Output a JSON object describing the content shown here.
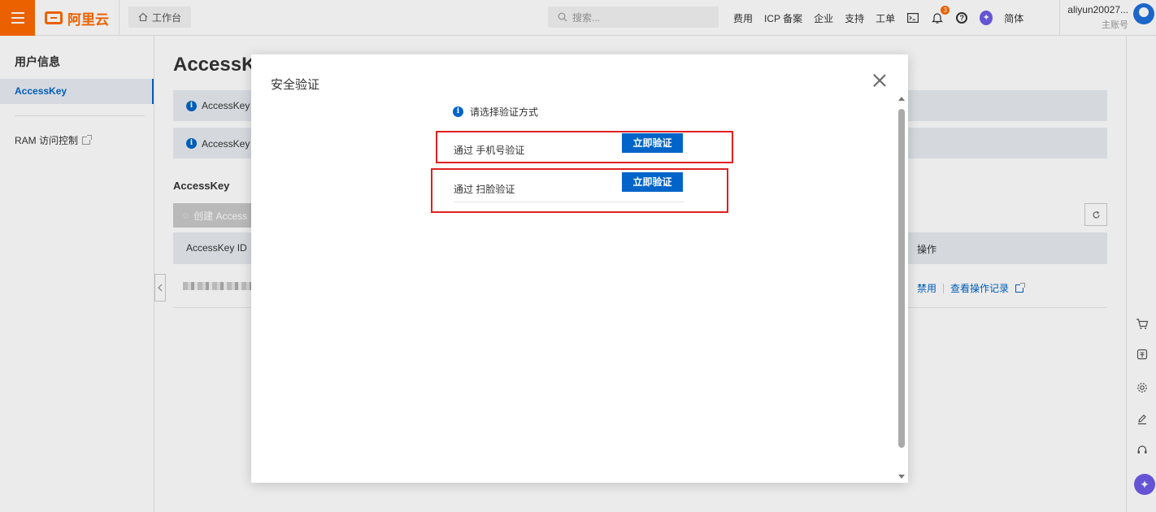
{
  "topbar": {
    "logo_text": "阿里云",
    "workbench_label": "工作台",
    "search_placeholder": "搜索...",
    "links": [
      "费用",
      "ICP 备案",
      "企业",
      "支持",
      "工单"
    ],
    "notification_count": "3",
    "help_glyph": "?",
    "language_label": "简体",
    "user_name": "aliyun20027...",
    "user_role": "主账号"
  },
  "sidebar": {
    "title": "用户信息",
    "active_item": "AccessKey",
    "ram_item": "RAM 访问控制"
  },
  "main": {
    "page_title": "AccessK",
    "alert1_text": "AccessKey ID",
    "alert2_text": "AccessKey 在",
    "section_title": "AccessKey",
    "create_button": "创建 Access",
    "table": {
      "col_id": "AccessKey ID",
      "col_actions": "操作",
      "row_action_disable": "禁用",
      "row_action_log": "查看操作记录"
    }
  },
  "modal": {
    "title": "安全验证",
    "hint": "请选择验证方式",
    "options": [
      {
        "label": "通过 手机号验证",
        "button": "立即验证"
      },
      {
        "label": "通过 扫脸验证",
        "button": "立即验证"
      }
    ]
  },
  "colors": {
    "brand_orange": "#ff6a00",
    "primary_blue": "#0064c8",
    "highlight_red": "#e02020"
  },
  "icons": {
    "menu": "hamburger-menu-icon",
    "home": "home-icon",
    "search": "search-icon",
    "bell": "bell-icon",
    "help": "help-circle-icon",
    "close": "close-icon",
    "info": "info-icon"
  }
}
